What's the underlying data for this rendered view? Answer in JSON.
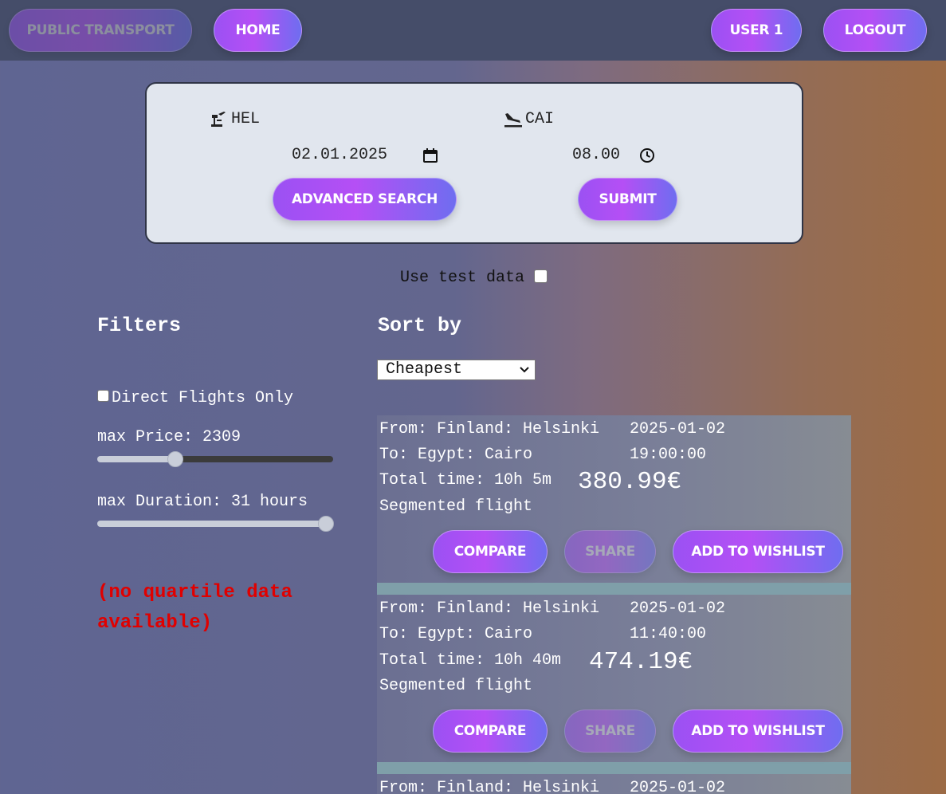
{
  "nav": {
    "public_transport": "PUBLIC TRANSPORT",
    "home": "HOME",
    "user": "USER 1",
    "logout": "LOGOUT"
  },
  "search": {
    "origin": "HEL",
    "destination": "CAI",
    "date": "02.01.2025",
    "time": "08.00",
    "advanced_label": "ADVANCED SEARCH",
    "submit_label": "SUBMIT"
  },
  "test_data_label": "Use test data",
  "filters": {
    "title": "Filters",
    "direct_only_label": "Direct Flights Only",
    "max_price_label": "max Price: 2309",
    "max_price_fraction": 0.33,
    "max_duration_label": "max Duration: 31 hours",
    "max_duration_fraction": 1.0,
    "no_quartile": "(no quartile data available)"
  },
  "sort": {
    "title": "Sort by",
    "selected": "Cheapest"
  },
  "flights": [
    {
      "from": "From: Finland: Helsinki",
      "to": "To: Egypt: Cairo",
      "total_time": "Total time: 10h 5m",
      "type": "Segmented flight",
      "date": "2025-01-02",
      "time": "19:00:00",
      "price": "380.99€"
    },
    {
      "from": "From: Finland: Helsinki",
      "to": "To: Egypt: Cairo",
      "total_time": "Total time: 10h 40m",
      "type": "Segmented flight",
      "date": "2025-01-02",
      "time": "11:40:00",
      "price": "474.19€"
    },
    {
      "from": "From: Finland: Helsinki",
      "date": "2025-01-02"
    }
  ],
  "card_buttons": {
    "compare": "COMPARE",
    "share": "SHARE",
    "wishlist": "ADD TO WISHLIST"
  },
  "colors": {
    "nav_bg": "#454d69",
    "button_gradient_start": "#9b51f3",
    "button_gradient_end": "#6f6df0",
    "error_text": "#e00000"
  }
}
